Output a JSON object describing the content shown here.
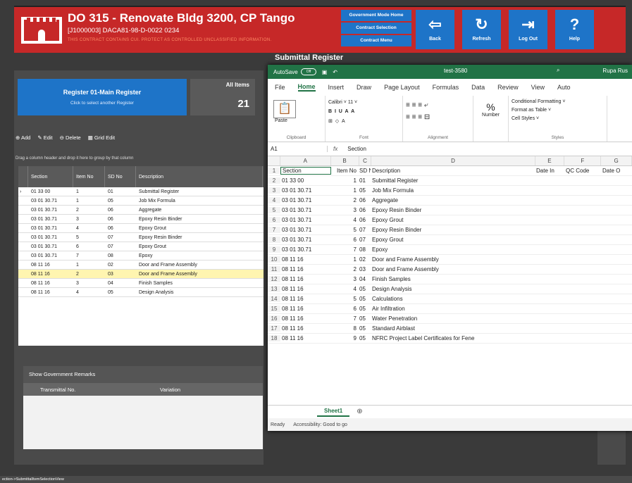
{
  "app": {
    "title": "DO 315 - Renovate Bldg 3200, CP Tango",
    "subtitle": "[J1000003] DACA81-98-D-0022  0234",
    "warning": "THIS CONTRACT CONTAINS CUI. PROTECT AS CONTROLLED UNCLASSIFIED INFORMATION.",
    "nav_stack": [
      "Government Mode Home",
      "Contract Selection",
      "Contract Menu"
    ],
    "buttons": [
      {
        "label": "Back",
        "icon": "⇦"
      },
      {
        "label": "Refresh",
        "icon": "↻"
      },
      {
        "label": "Log Out",
        "icon": "⇥"
      },
      {
        "label": "Help",
        "icon": "?"
      }
    ],
    "colors": {
      "header": "#c62828",
      "accent": "#1e74c8",
      "excel": "#217346"
    }
  },
  "page_title": "Submittal Register",
  "register": {
    "title": "Register 01-Main Register",
    "hint": "Click to select another Register",
    "count_label": "All Items",
    "count": "21"
  },
  "toolbar": [
    "Add",
    "Edit",
    "Delete",
    "Grid Edit"
  ],
  "group_hint": "Drag a column header and drop it here to group by that column",
  "grid": {
    "headers": [
      "Section",
      "Item No",
      "SD No",
      "Description"
    ],
    "rows": [
      [
        "01 33 00",
        "1",
        "01",
        "Submittal Register"
      ],
      [
        "03 01 30.71",
        "1",
        "05",
        "Job Mix Formula"
      ],
      [
        "03 01 30.71",
        "2",
        "06",
        "Aggregate"
      ],
      [
        "03 01 30.71",
        "3",
        "06",
        "Epoxy Resin Binder"
      ],
      [
        "03 01 30.71",
        "4",
        "06",
        "Epoxy Grout"
      ],
      [
        "03 01 30.71",
        "5",
        "07",
        "Epoxy Resin Binder"
      ],
      [
        "03 01 30.71",
        "6",
        "07",
        "Epoxy Grout"
      ],
      [
        "03 01 30.71",
        "7",
        "08",
        "Epoxy"
      ],
      [
        "08 11 16",
        "1",
        "02",
        "Door and Frame Assembly"
      ],
      [
        "08 11 16",
        "2",
        "03",
        "Door and Frame Assembly"
      ],
      [
        "08 11 16",
        "3",
        "04",
        "Finish Samples"
      ],
      [
        "08 11 16",
        "4",
        "05",
        "Design Analysis"
      ]
    ]
  },
  "remarks": {
    "title": "Show Government Remarks",
    "col1": "Transmittal No.",
    "col2": "Variation"
  },
  "status_path": "ection->SubmittalItemSelectionView",
  "excel": {
    "autosave": "AutoSave",
    "toggle": "Off",
    "file": "test-3580",
    "user": "Rupa Rus",
    "tabs": [
      "File",
      "Home",
      "Insert",
      "Draw",
      "Page Layout",
      "Formulas",
      "Data",
      "Review",
      "View",
      "Auto"
    ],
    "ribbon": {
      "clipboard": "Clipboard",
      "paste": "Paste",
      "font_name": "Calibri",
      "font_size": "11",
      "font": "Font",
      "alignment": "Alignment",
      "number": "Number",
      "conditional": "Conditional Formatting ˅",
      "format_table": "Format as Table ˅",
      "cell_styles": "Cell Styles ˅",
      "styles": "Styles"
    },
    "cell_ref": "A1",
    "formula": "Section",
    "columns": [
      "A",
      "B",
      "C",
      "D",
      "E",
      "F",
      "G"
    ],
    "header_row": [
      "Section",
      "Item No",
      "SD No",
      "Description",
      "Date In",
      "QC Code",
      "Date O"
    ],
    "rows": [
      [
        "2",
        "01 33 00",
        "1",
        "01",
        "Submittal Register"
      ],
      [
        "3",
        "03 01 30.71",
        "1",
        "05",
        "Job Mix Formula"
      ],
      [
        "4",
        "03 01 30.71",
        "2",
        "06",
        "Aggregate"
      ],
      [
        "5",
        "03 01 30.71",
        "3",
        "06",
        "Epoxy Resin Binder"
      ],
      [
        "6",
        "03 01 30.71",
        "4",
        "06",
        "Epoxy Grout"
      ],
      [
        "7",
        "03 01 30.71",
        "5",
        "07",
        "Epoxy Resin Binder"
      ],
      [
        "8",
        "03 01 30.71",
        "6",
        "07",
        "Epoxy Grout"
      ],
      [
        "9",
        "03 01 30.71",
        "7",
        "08",
        "Epoxy"
      ],
      [
        "10",
        "08 11 16",
        "1",
        "02",
        "Door and Frame Assembly"
      ],
      [
        "11",
        "08 11 16",
        "2",
        "03",
        "Door and Frame Assembly"
      ],
      [
        "12",
        "08 11 16",
        "3",
        "04",
        "Finish Samples"
      ],
      [
        "13",
        "08 11 16",
        "4",
        "05",
        "Design Analysis"
      ],
      [
        "14",
        "08 11 16",
        "5",
        "05",
        "Calculations"
      ],
      [
        "15",
        "08 11 16",
        "6",
        "05",
        "Air Infiltration"
      ],
      [
        "16",
        "08 11 16",
        "7",
        "05",
        "Water Penetration"
      ],
      [
        "17",
        "08 11 16",
        "8",
        "05",
        "Standard Airblast"
      ],
      [
        "18",
        "08 11 16",
        "9",
        "05",
        "NFRC Project Label Certificates for Fene"
      ]
    ],
    "sheet_tab": "Sheet1",
    "status": [
      "Ready",
      "Accessibility: Good to go"
    ]
  }
}
